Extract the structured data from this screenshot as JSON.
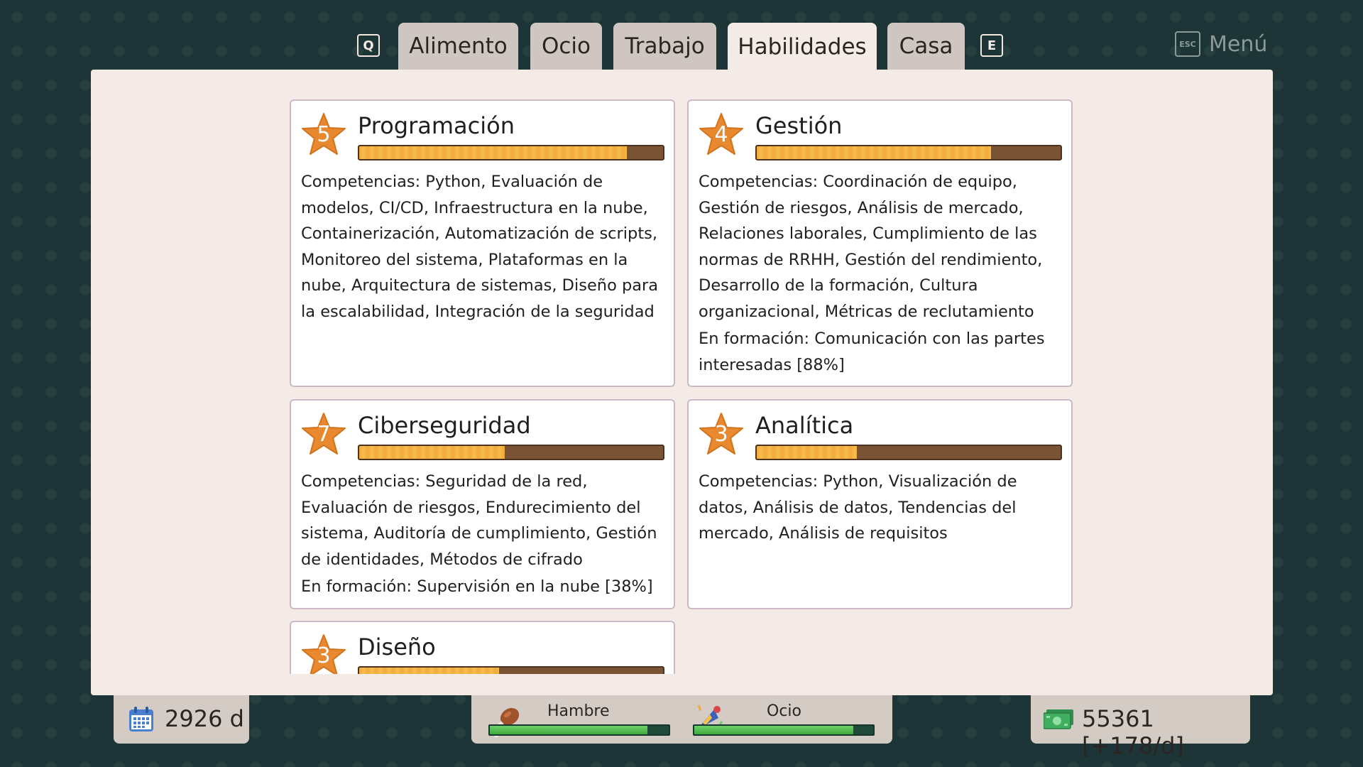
{
  "tabs": {
    "prev_key": "Q",
    "next_key": "E",
    "items": [
      {
        "label": "Alimento"
      },
      {
        "label": "Ocio"
      },
      {
        "label": "Trabajo"
      },
      {
        "label": "Habilidades"
      },
      {
        "label": "Casa"
      }
    ],
    "active": "Habilidades"
  },
  "menu": {
    "key": "ESC",
    "label": "Menú"
  },
  "skills": [
    {
      "level": "5",
      "name": "Programación",
      "progress": 0.88,
      "competencias": "Competencias: Python, Evaluación de modelos, CI/CD, Infraestructura en la nube, Containerización, Automatización de scripts, Monitoreo del sistema, Plataformas en la nube, Arquitectura de sistemas, Diseño para la escalabilidad, Integración de la seguridad",
      "formacion": ""
    },
    {
      "level": "4",
      "name": "Gestión",
      "progress": 0.77,
      "competencias": "Competencias: Coordinación de equipo, Gestión de riesgos, Análisis de mercado, Relaciones laborales, Cumplimiento de las normas de RRHH, Gestión del rendimiento, Desarrollo de la formación, Cultura organizacional, Métricas de reclutamiento",
      "formacion": "En formación: Comunicación con las partes interesadas [88%]"
    },
    {
      "level": "7",
      "name": "Ciberseguridad",
      "progress": 0.48,
      "competencias": "Competencias: Seguridad de la red, Evaluación de riesgos, Endurecimiento del sistema, Auditoría de cumplimiento, Gestión de identidades, Métodos de cifrado",
      "formacion": "En formación: Supervisión en la nube [38%]"
    },
    {
      "level": "3",
      "name": "Analítica",
      "progress": 0.33,
      "competencias": "Competencias: Python, Visualización de datos, Análisis de datos, Tendencias del mercado, Análisis de requisitos",
      "formacion": ""
    },
    {
      "level": "3",
      "name": "Diseño",
      "progress": 0.46,
      "competencias": "",
      "formacion": ""
    }
  ],
  "status": {
    "days": "2926 d",
    "hunger": {
      "label": "Hambre",
      "value": 0.88
    },
    "leisure": {
      "label": "Ocio",
      "value": 0.89
    },
    "money": "55361 [+178/d]"
  },
  "colors": {
    "accent_orange": "#e8892f",
    "panel_bg": "#f5ebe6",
    "bar_fill": "#f2a93b",
    "bar_track": "#7a5234",
    "stat_green": "#4cba49"
  },
  "icons": {
    "calendar": "calendar-icon",
    "hunger": "drumstick-icon",
    "leisure": "party-horn-icon",
    "money": "cash-icon",
    "level": "star-icon"
  }
}
